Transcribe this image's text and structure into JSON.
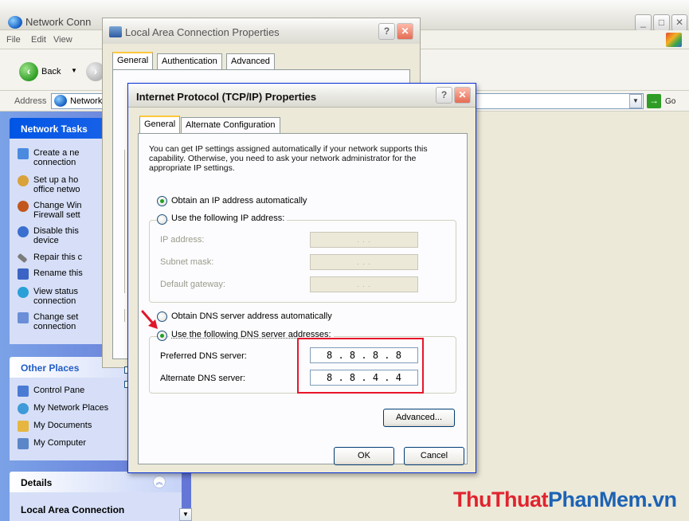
{
  "explorer": {
    "title": "Network Conn",
    "menu": [
      "File",
      "Edit",
      "View"
    ],
    "back_label": "Back",
    "address_label": "Address",
    "address_value": "Network",
    "go_label": "Go",
    "tasks_header": "Network Tasks",
    "tasks": [
      {
        "line1": "Create a ne",
        "line2": "connection",
        "icon": "new-connection-icon",
        "color": "#4a8be0"
      },
      {
        "line1": "Set up a ho",
        "line2": "office netwo",
        "icon": "home-network-icon",
        "color": "#d9a23a"
      },
      {
        "line1": "Change Win",
        "line2": "Firewall sett",
        "icon": "firewall-icon",
        "color": "#c2571d"
      },
      {
        "line1": "Disable this",
        "line2": "device",
        "icon": "disable-device-icon",
        "color": "#3a6fd0"
      },
      {
        "line1": "Repair this c",
        "line2": "",
        "icon": "repair-icon",
        "color": "#7b7b7b"
      },
      {
        "line1": "Rename this",
        "line2": "",
        "icon": "rename-icon",
        "color": "#3b64c4"
      },
      {
        "line1": "View status",
        "line2": "connection",
        "icon": "status-icon",
        "color": "#2aa0d8"
      },
      {
        "line1": "Change set",
        "line2": "connection",
        "icon": "settings-icon",
        "color": "#6a8fd8"
      }
    ],
    "other_places_header": "Other Places",
    "other_places": [
      {
        "label": "Control Pane",
        "icon": "control-panel-icon",
        "color": "#4a7bd4"
      },
      {
        "label": "My Network Places",
        "icon": "network-places-icon",
        "color": "#3e9ad8"
      },
      {
        "label": "My Documents",
        "icon": "documents-icon",
        "color": "#e7b640"
      },
      {
        "label": "My Computer",
        "icon": "computer-icon",
        "color": "#5b86c8"
      }
    ],
    "details_header": "Details",
    "details_title": "Local Area Connection"
  },
  "lac_dialog": {
    "title": "Local Area Connection Properties",
    "tabs": [
      "General",
      "Authentication",
      "Advanced"
    ]
  },
  "tcp_dialog": {
    "title": "Internet Protocol (TCP/IP) Properties",
    "tabs": [
      "General",
      "Alternate Configuration"
    ],
    "description": "You can get IP settings assigned automatically if your network supports this capability. Otherwise, you need to ask your network administrator for the appropriate IP settings.",
    "ip_auto_label": "Obtain an IP address automatically",
    "ip_manual_label": "Use the following IP address:",
    "ip_mode": "auto",
    "ip_fields": [
      {
        "label": "IP address:",
        "value": ".  .  ."
      },
      {
        "label": "Subnet mask:",
        "value": ".  .  ."
      },
      {
        "label": "Default gateway:",
        "value": ".  .  ."
      }
    ],
    "dns_auto_label": "Obtain DNS server address automatically",
    "dns_manual_label": "Use the following DNS server addresses:",
    "dns_mode": "manual",
    "preferred_dns_label": "Preferred DNS server:",
    "preferred_dns_value": "8  .  8  .  8  .  8",
    "alternate_dns_label": "Alternate DNS server:",
    "alternate_dns_value": "8  .  8  .  4  .  4",
    "advanced_button": "Advanced...",
    "ok_button": "OK",
    "cancel_button": "Cancel"
  },
  "watermark": {
    "part1": "ThuThuat",
    "part2": "PhanMem",
    "part3": ".vn",
    "color_red": "#e0242f",
    "color_blue": "#1d63b5"
  },
  "colors": {
    "xp_blue": "#0055e5",
    "highlight_red": "#e8152a",
    "arrow_red": "#e0172b"
  }
}
